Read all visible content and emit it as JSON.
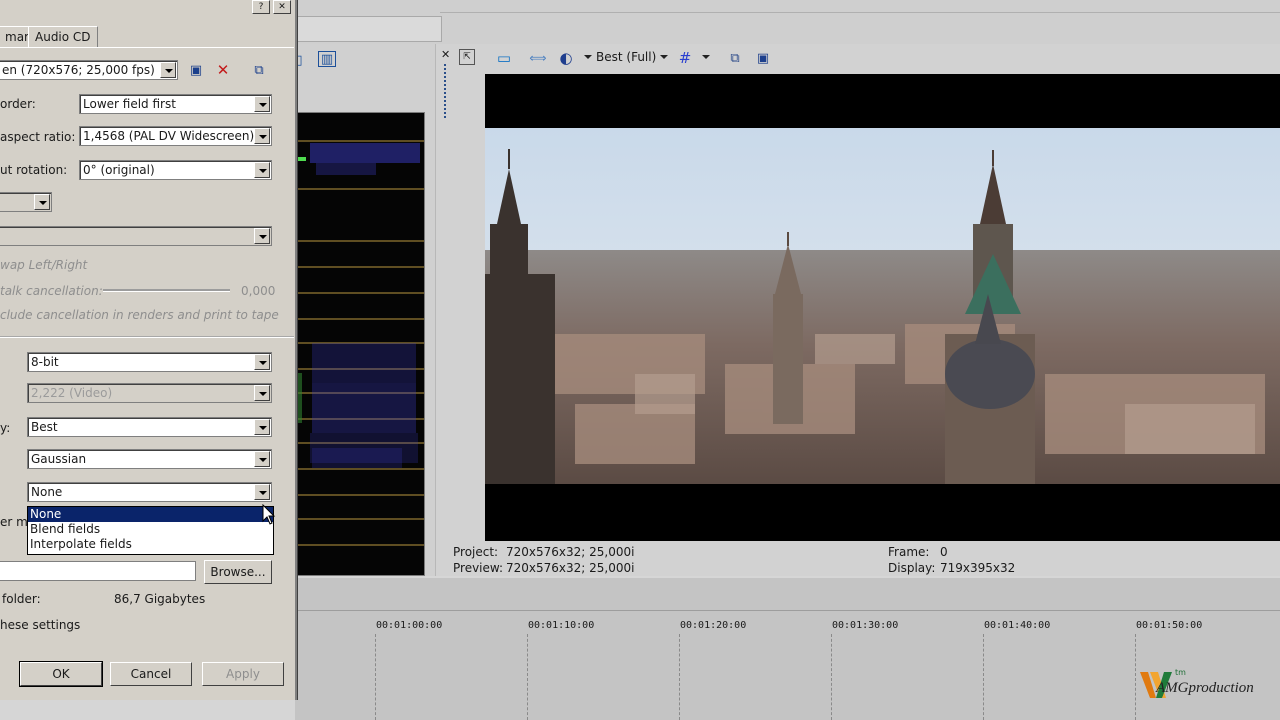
{
  "dialog": {
    "tabs": [
      "mary",
      "Audio CD"
    ],
    "template_value": "en (720x576; 25,000 fps)",
    "field_order": {
      "label": "order:",
      "value": "Lower field first"
    },
    "pixel_aspect": {
      "label": "aspect ratio:",
      "value": "1,4568 (PAL DV Widescreen)"
    },
    "rotation": {
      "label": "ut rotation:",
      "value": "0° (original)"
    },
    "swap_label": "wap Left/Right",
    "crosstalk": {
      "label": "talk cancellation:",
      "value": "0,000"
    },
    "include_label": "clude cancellation in renders and print to tape",
    "pixel_format": "8-bit",
    "gamma": "2,222 (Video)",
    "quality": {
      "label": "y:",
      "value": "Best"
    },
    "resample": "Gaussian",
    "deinterlace": {
      "label": "er m",
      "value": "None"
    },
    "dropdown_options": [
      "None",
      "Blend fields",
      "Interpolate fields"
    ],
    "browse_label": "Browse...",
    "folder": {
      "label": "folder:",
      "value": "86,7 Gigabytes"
    },
    "save_settings_label": "hese settings",
    "buttons": {
      "ok": "OK",
      "cancel": "Cancel",
      "apply": "Apply"
    }
  },
  "preview_toolbar": {
    "quality": "Best (Full)"
  },
  "preview_info": {
    "project_label": "Project:",
    "project_value": "720x576x32; 25,000i",
    "preview_label": "Preview:",
    "preview_value": "720x576x32; 25,000i",
    "frame_label": "Frame:",
    "frame_value": "0",
    "display_label": "Display:",
    "display_value": "719x395x32"
  },
  "timeline": {
    "ticks": [
      "00:01:00:00",
      "00:01:10:00",
      "00:01:20:00",
      "00:01:30:00",
      "00:01:40:00",
      "00:01:50:00"
    ]
  },
  "watermark": {
    "text": "AMGproduction",
    "tm": "tm"
  },
  "colors": {
    "dialog_bg": "#d4d0c8",
    "selection": "#0a246a",
    "scope_line": "#e8c840"
  }
}
